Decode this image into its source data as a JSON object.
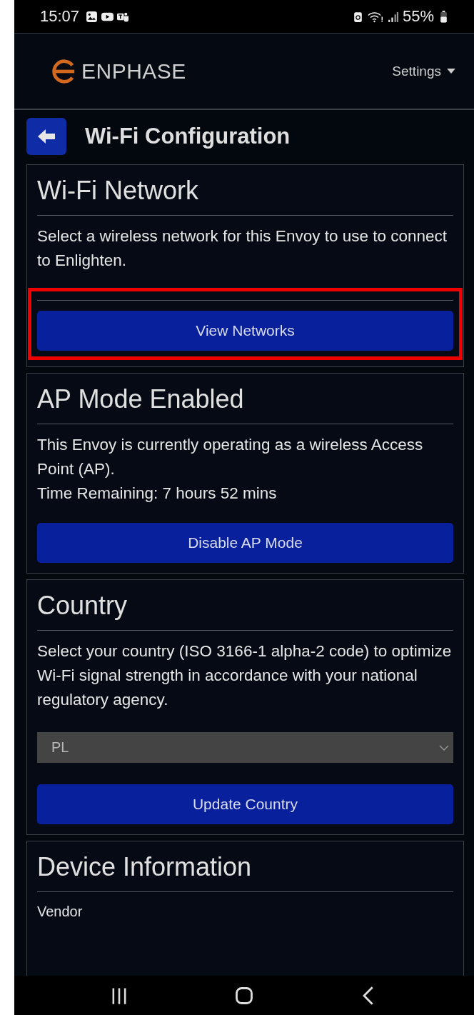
{
  "status_bar": {
    "time": "15:07",
    "battery": "55%"
  },
  "header": {
    "logo": "ENPHASE",
    "settings_menu": "Settings"
  },
  "page_title": "Wi-Fi Configuration",
  "cards": [
    {
      "title": "Wi-Fi Network",
      "lines": [
        "Select a wireless network for this Envoy to use to connect to Enlighten."
      ],
      "divider_before_button": true,
      "button": "View Networks",
      "highlighted": true
    },
    {
      "title": "AP Mode Enabled",
      "lines": [
        "This Envoy is currently operating as a wireless Access Point (AP).",
        "Time Remaining: 7 hours 52 mins"
      ],
      "button": "Disable AP Mode"
    },
    {
      "title": "Country",
      "lines": [
        "Select your country (ISO 3166-1 alpha-2 code) to optimize Wi-Fi signal strength in accordance with your national regulatory agency."
      ],
      "select": {
        "value": "PL"
      },
      "button": "Update Country"
    },
    {
      "title": "Device Information",
      "fields": [
        "Vendor"
      ]
    }
  ]
}
